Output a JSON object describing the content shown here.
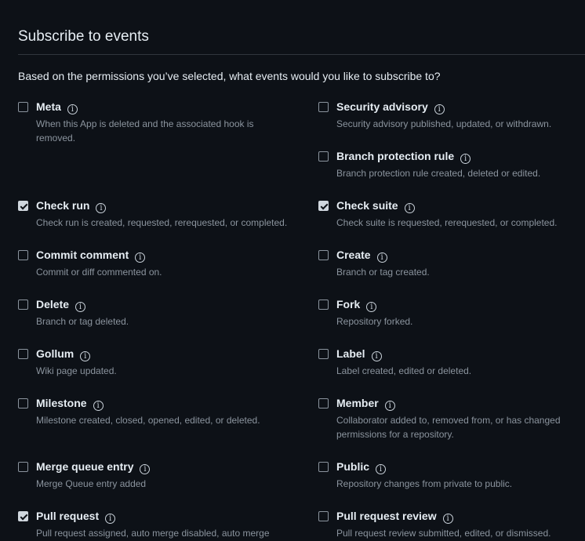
{
  "page": {
    "title": "Subscribe to events",
    "intro": "Based on the permissions you’ve selected, what events would you like to subscribe to?"
  },
  "events": [
    {
      "name": "Meta",
      "description": "When this App is deleted and the associated hook is removed.",
      "checked": false
    },
    {
      "name": "Security advisory",
      "description": "Security advisory published, updated, or withdrawn.",
      "checked": false
    },
    {
      "name": "Branch protection rule",
      "description": "Branch protection rule created, deleted or edited.",
      "checked": false
    },
    {
      "name": "Check run",
      "description": "Check run is created, requested, rerequested, or completed.",
      "checked": true
    },
    {
      "name": "Check suite",
      "description": "Check suite is requested, rerequested, or completed.",
      "checked": true
    },
    {
      "name": "Commit comment",
      "description": "Commit or diff commented on.",
      "checked": false
    },
    {
      "name": "Create",
      "description": "Branch or tag created.",
      "checked": false
    },
    {
      "name": "Delete",
      "description": "Branch or tag deleted.",
      "checked": false
    },
    {
      "name": "Fork",
      "description": "Repository forked.",
      "checked": false
    },
    {
      "name": "Gollum",
      "description": "Wiki page updated.",
      "checked": false
    },
    {
      "name": "Label",
      "description": "Label created, edited or deleted.",
      "checked": false
    },
    {
      "name": "Milestone",
      "description": "Milestone created, closed, opened, edited, or deleted.",
      "checked": false
    },
    {
      "name": "Member",
      "description": "Collaborator added to, removed from, or has changed permissions for a repository.",
      "checked": false
    },
    {
      "name": "Merge queue entry",
      "description": "Merge Queue entry added",
      "checked": false
    },
    {
      "name": "Public",
      "description": "Repository changes from private to public.",
      "checked": false
    },
    {
      "name": "Pull request",
      "description": "Pull request assigned, auto merge disabled, auto merge",
      "checked": true
    },
    {
      "name": "Pull request review",
      "description": "Pull request review submitted, edited, or dismissed.",
      "checked": false
    }
  ]
}
